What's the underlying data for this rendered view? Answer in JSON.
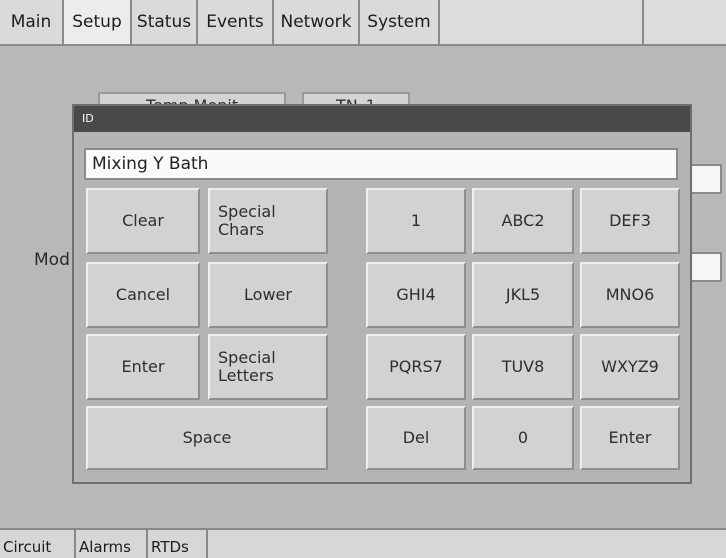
{
  "top_tabs": [
    "Main",
    "Setup",
    "Status",
    "Events",
    "Network",
    "System"
  ],
  "background": {
    "button1": "Temp Monit",
    "button2": "TN_1",
    "side_label": "Mod"
  },
  "bottom_tabs": [
    "Circuit",
    "Alarms",
    "RTDs"
  ],
  "dialog": {
    "title": "ID",
    "input_value": "Mixing Y Bath",
    "keys": {
      "clear": "Clear",
      "special_chars": "Special Chars",
      "cancel": "Cancel",
      "lower": "Lower",
      "enter_left": "Enter",
      "special_letters": "Special Letters",
      "space": "Space",
      "k1": "1",
      "k2": "ABC2",
      "k3": "DEF3",
      "k4": "GHI4",
      "k5": "JKL5",
      "k6": "MNO6",
      "k7": "PQRS7",
      "k8": "TUV8",
      "k9": "WXYZ9",
      "del": "Del",
      "k0": "0",
      "enter_right": "Enter"
    }
  }
}
